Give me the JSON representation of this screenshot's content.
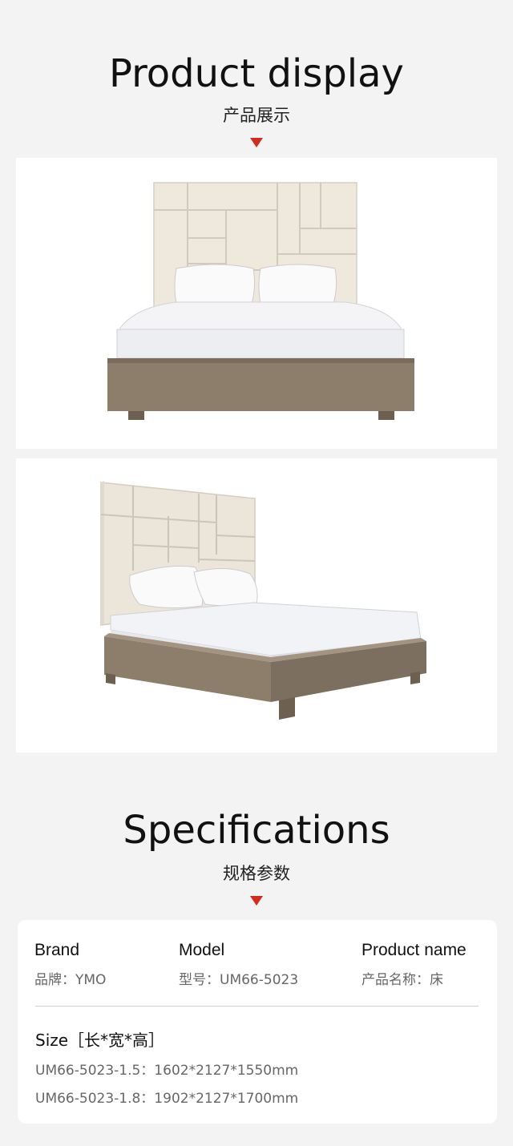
{
  "display": {
    "title": "Product display",
    "subtitle": "产品展示"
  },
  "images": [
    {
      "icon": "bed-front-view-image"
    },
    {
      "icon": "bed-angle-view-image"
    }
  ],
  "specs": {
    "title": "Specifications",
    "subtitle": "规格参数",
    "columns": [
      {
        "head": "Brand",
        "value": "品牌：YMO"
      },
      {
        "head": "Model",
        "value": "型号：UM66-5023"
      },
      {
        "head": "Product name",
        "value": "产品名称：床"
      }
    ],
    "size": {
      "head": "Size［长*宽*高］",
      "lines": [
        "UM66-5023-1.5：1602*2127*1550mm",
        "UM66-5023-1.8：1902*2127*1700mm"
      ]
    }
  },
  "colors": {
    "accent": "#d42b1d",
    "page_bg": "#f3f3f3",
    "card_bg": "#ffffff",
    "wood": "#8a7a68",
    "upholstery": "#ece6da"
  }
}
